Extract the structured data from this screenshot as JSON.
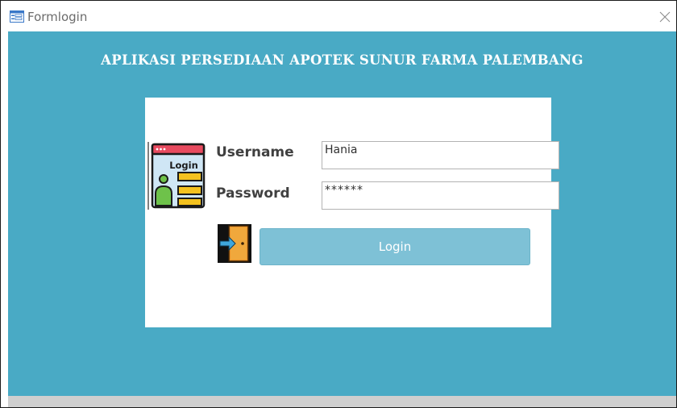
{
  "window": {
    "title": "Formlogin",
    "icon": "form-icon",
    "close_icon": "close-icon"
  },
  "app": {
    "title": "APLIKASI PERSEDIAAN APOTEK SUNUR FARMA PALEMBANG"
  },
  "login_form": {
    "illustration_text": "Login",
    "username_label": "Username",
    "username_value": "Hania",
    "password_label": "Password",
    "password_value": "******",
    "login_button_label": "Login",
    "login_button_icon": "door-exit-icon"
  },
  "colors": {
    "background": "#49aac5",
    "panel": "#ffffff",
    "button": "#7ec1d6",
    "title_text": "#ffffff"
  }
}
